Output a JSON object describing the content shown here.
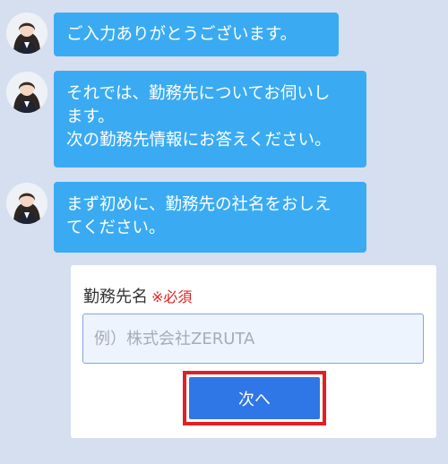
{
  "messages": [
    {
      "lines": [
        "ご入力ありがとうございます。"
      ]
    },
    {
      "lines": [
        "それでは、勤務先についてお伺いし",
        "ます。",
        "次の勤務先情報にお答えください。"
      ]
    },
    {
      "lines": [
        "まず初めに、勤務先の社名をおしえ",
        "てください。"
      ]
    }
  ],
  "avatar_icon": "user-avatar-icon",
  "form": {
    "label": "勤務先名",
    "required": "※必須",
    "input_value": "",
    "input_placeholder": "例）株式会社ZERUTA",
    "next_label": "次へ"
  },
  "colors": {
    "background": "#d6dff0",
    "bubble": "#3aabf2",
    "button": "#2f76e6",
    "highlight": "#e21f26",
    "required": "#e11f1f"
  }
}
